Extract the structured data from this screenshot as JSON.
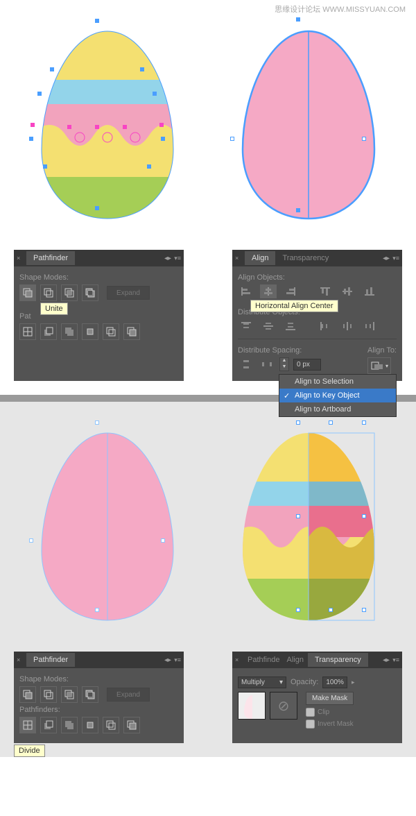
{
  "watermark": "思缘设计论坛 WWW.MISSYUAN.COM",
  "pathfinder_panel_1": {
    "tab": "Pathfinder",
    "shape_modes_label": "Shape Modes:",
    "expand": "Expand",
    "pathfinders_label_partial": "Pat",
    "tooltip": "Unite"
  },
  "align_panel": {
    "tab_align": "Align",
    "tab_transparency": "Transparency",
    "align_objects_label": "Align Objects:",
    "distribute_objects_label": "Distribute Objects:",
    "distribute_spacing_label": "Distribute Spacing:",
    "align_to_label": "Align To:",
    "spacing_value": "0 px",
    "tooltip": "Horizontal Align Center",
    "menu": {
      "item1": "Align to Selection",
      "item2": "Align to Key Object",
      "item3": "Align to Artboard"
    }
  },
  "pathfinder_panel_2": {
    "tab": "Pathfinder",
    "shape_modes_label": "Shape Modes:",
    "expand": "Expand",
    "pathfinders_label": "Pathfinders:",
    "tooltip": "Divide"
  },
  "transparency_panel": {
    "tab_pf": "Pathfinde",
    "tab_align": "Align",
    "tab_transparency": "Transparency",
    "blend_mode": "Multiply",
    "opacity_label": "Opacity:",
    "opacity_value": "100%",
    "make_mask": "Make Mask",
    "clip": "Clip",
    "invert_mask": "Invert Mask"
  },
  "colors": {
    "yellow": "#f4e071",
    "blue": "#93d4ea",
    "pink": "#f2a3bd",
    "green": "#a5ce56",
    "pink_solid": "#f5a9c5",
    "sel_blue": "#4a9eff",
    "sel_light": "#8ec5ff",
    "orange": "#f5c142",
    "blue2": "#7fb8c9",
    "pink2": "#e96f8d",
    "olive": "#98a83e",
    "dk_yellow": "#d9b940"
  }
}
